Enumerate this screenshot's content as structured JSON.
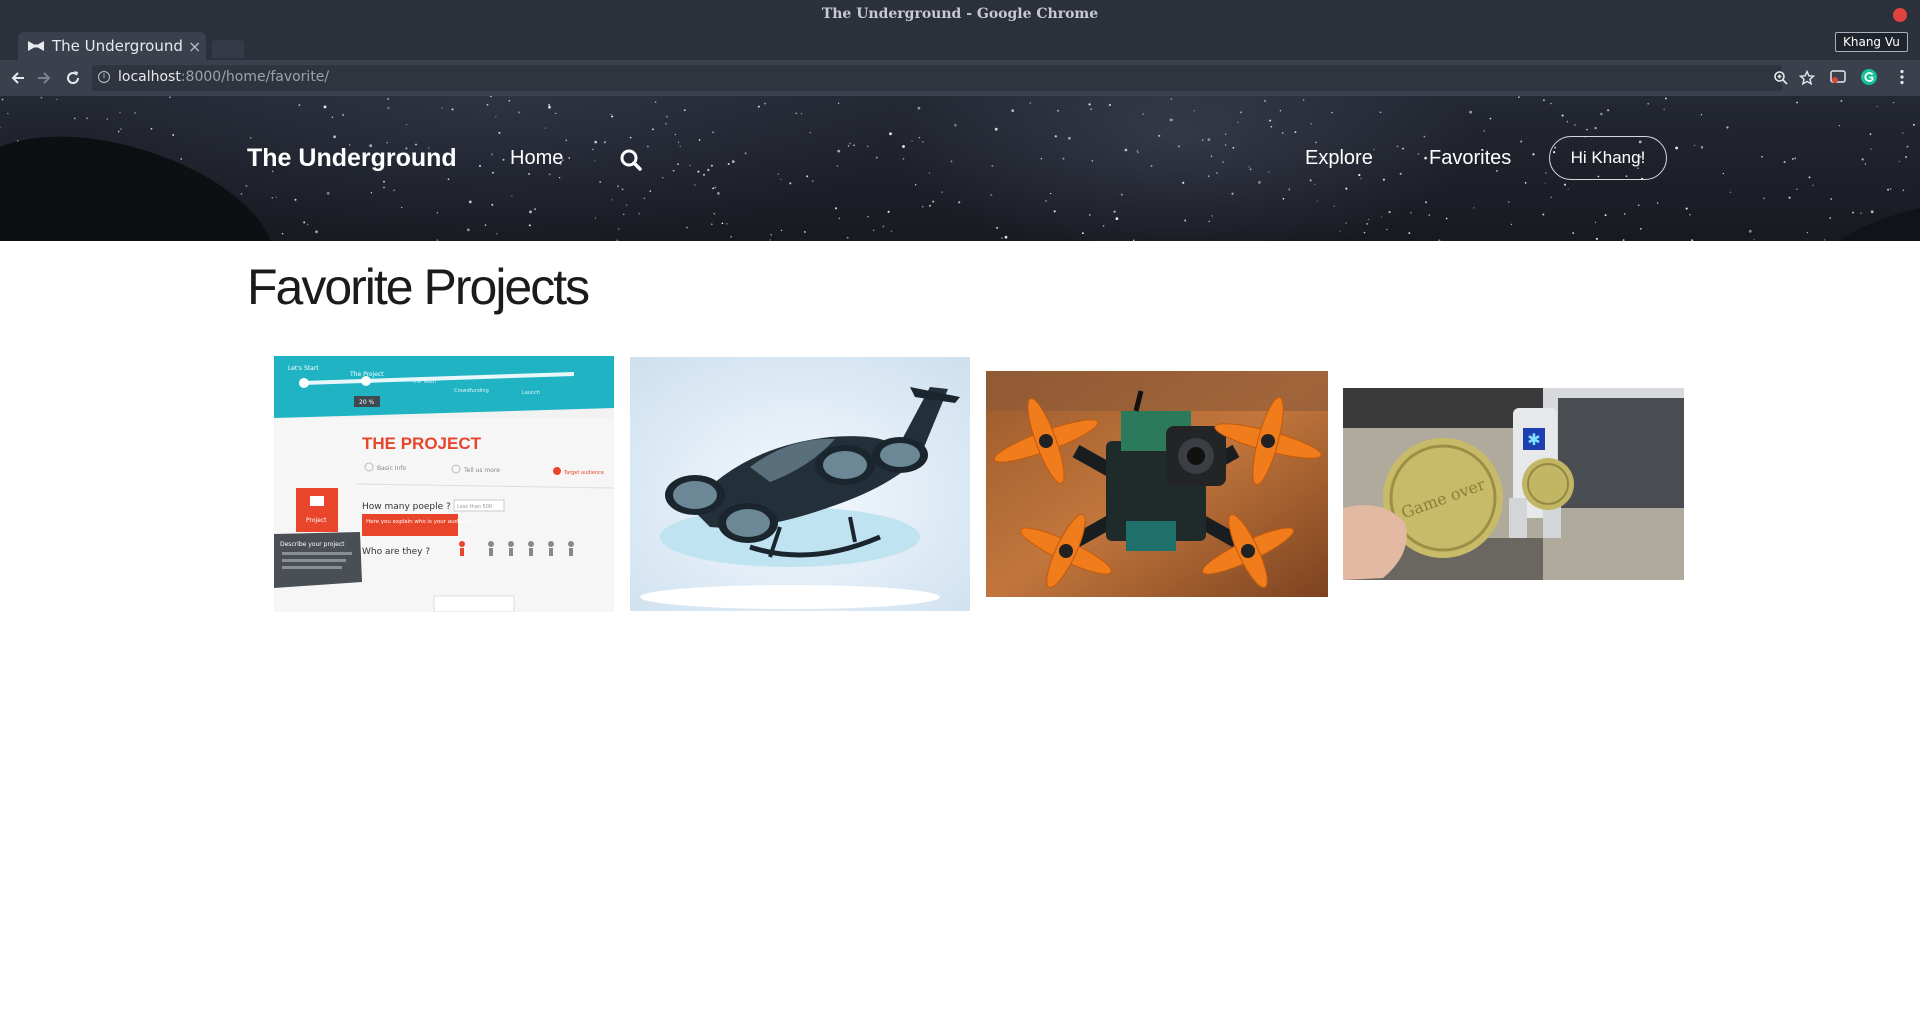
{
  "browser": {
    "window_title": "The Underground - Google Chrome",
    "tab_title": "The Underground",
    "tab_close": "×",
    "url_host": "localhost",
    "url_rest": ":8000/home/favorite/",
    "profile_name": "Khang Vu"
  },
  "site": {
    "brand": "The Underground",
    "nav": {
      "home": "Home",
      "explore": "Explore",
      "favorites": "Favorites",
      "greeting": "Hi Khang!"
    }
  },
  "main": {
    "title": "Favorite Projects",
    "projects": [
      {
        "image": "project-ui-screenshot",
        "text": {
          "step1": "Let's Start",
          "step2": "The Project",
          "step3": "The Team",
          "step4": "Crowdfunding",
          "step5": "Launch",
          "progress": "20 %",
          "heading": "THE PROJECT",
          "tab_basic": "Basic Info",
          "tab_tell": "Tell us more",
          "tab_target": "Target audience",
          "question1": "How many poeple ?",
          "answer1": "Less than 500",
          "hint": "Here you explain who is your audience.",
          "question2": "Who are they ?",
          "badge": "Project",
          "describe": "Describe your project"
        }
      },
      {
        "image": "flying-car-render"
      },
      {
        "image": "fpv-racing-drone"
      },
      {
        "image": "robot-with-coins",
        "text": {
          "coin": "Game over"
        }
      }
    ]
  }
}
